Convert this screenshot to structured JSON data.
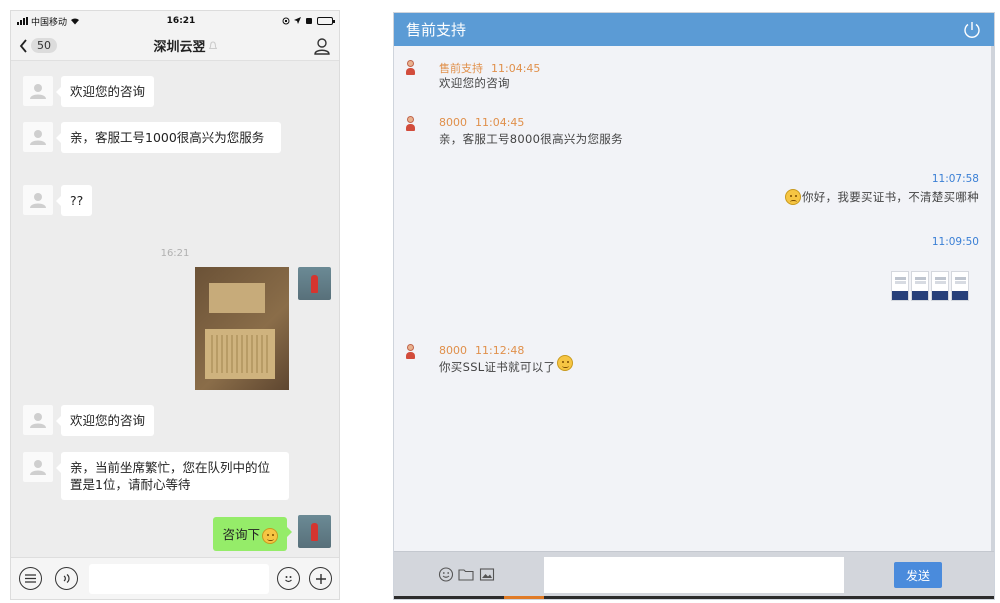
{
  "phone": {
    "status": {
      "carrier": "中国移动",
      "time": "16:21"
    },
    "nav": {
      "back_count": "50",
      "title": "深圳云翌"
    },
    "messages": [
      {
        "text": "欢迎您的咨询"
      },
      {
        "text": "亲，客服工号1000很高兴为您服务"
      },
      {
        "text": "??"
      },
      {
        "time": "16:21"
      },
      {
        "text": "欢迎您的咨询"
      },
      {
        "text": "亲，当前坐席繁忙，您在队列中的位置是1位，请耐心等待"
      },
      {
        "text": "咨询下"
      }
    ]
  },
  "desktop": {
    "title": "售前支持",
    "messages": [
      {
        "sender": "售前支持",
        "time": "11:04:45",
        "text": "欢迎您的咨询"
      },
      {
        "sender": "8000",
        "time": "11:04:45",
        "text": "亲，客服工号8000很高兴为您服务"
      },
      {
        "time": "11:07:58",
        "text": "你好，我要买证书，不清楚买哪种"
      },
      {
        "time": "11:09:50"
      },
      {
        "sender": "8000",
        "time": "11:12:48",
        "text": "你买SSL证书就可以了"
      }
    ],
    "send_label": "发送"
  },
  "colors": {
    "wechat_green": "#95ec69",
    "header_blue": "#5b9bd5",
    "sender_orange": "#e0904b",
    "time_blue": "#3a7fd5"
  }
}
